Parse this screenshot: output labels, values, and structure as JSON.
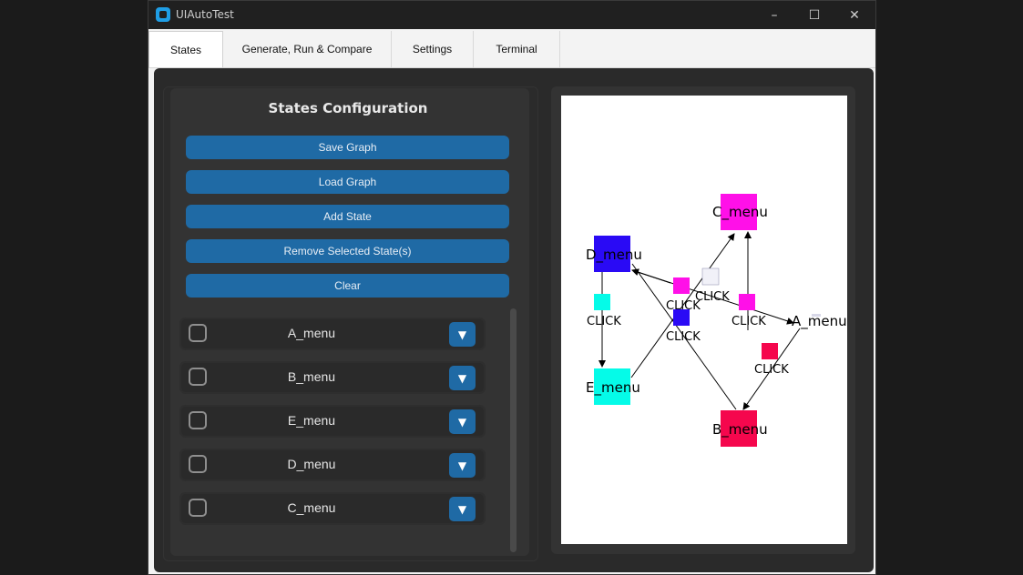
{
  "window": {
    "title": "UIAutoTest"
  },
  "tabs": [
    {
      "label": "States"
    },
    {
      "label": "Generate, Run & Compare"
    },
    {
      "label": "Settings"
    },
    {
      "label": "Terminal"
    }
  ],
  "panel": {
    "title": "States Configuration",
    "buttons": {
      "save": "Save Graph",
      "load": "Load Graph",
      "add": "Add State",
      "remove": "Remove Selected State(s)",
      "clear": "Clear"
    }
  },
  "states": [
    {
      "label": "A_menu",
      "checked": false
    },
    {
      "label": "B_menu",
      "checked": false
    },
    {
      "label": "E_menu",
      "checked": false
    },
    {
      "label": "D_menu",
      "checked": false
    },
    {
      "label": "C_menu",
      "checked": false
    }
  ],
  "graph": {
    "nodes": [
      {
        "label": "C_menu",
        "color": "#ff10e8"
      },
      {
        "label": "D_menu",
        "color": "#2a0af5"
      },
      {
        "label": "E_menu",
        "color": "#05fbe8"
      },
      {
        "label": "B_menu",
        "color": "#f5074d"
      },
      {
        "label": "A_menu",
        "color": ""
      }
    ],
    "edge_labels": [
      "CLICK",
      "CLICK",
      "CLICK",
      "CLICK",
      "CLICK",
      "CLICK"
    ]
  },
  "icons": {
    "minimize": "minimize-icon",
    "maximize": "maximize-icon",
    "close": "close-icon",
    "dropdown": "chevron-down-icon"
  }
}
